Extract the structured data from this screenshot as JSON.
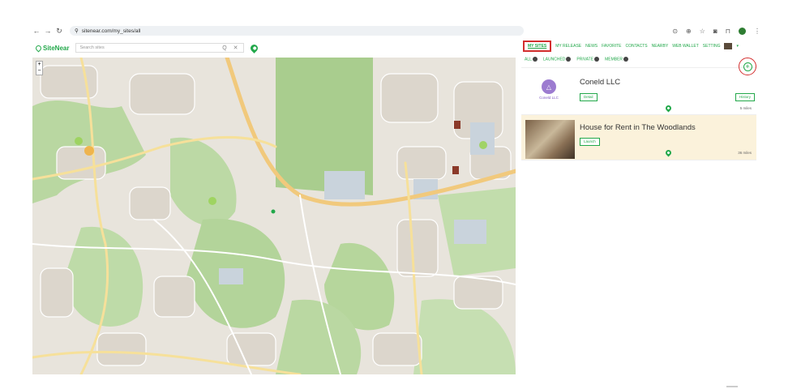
{
  "browser": {
    "url": "sitenear.com/my_sites/all",
    "nav_icons": [
      "back-icon",
      "forward-icon",
      "reload-icon"
    ],
    "right_icons": [
      "location-icon",
      "zoom-icon",
      "star-icon",
      "camera-icon",
      "extension-icon",
      "menu-icon"
    ]
  },
  "site": {
    "logo_text": "SiteNear",
    "search_placeholder": "Search sites",
    "search_tools": "Q ✕"
  },
  "nav": {
    "items": [
      "MY SITES",
      "MY RELEASE",
      "NEWS",
      "FAVORITE",
      "CONTACTS",
      "NEARBY",
      "WEB WALLET",
      "SETTING"
    ]
  },
  "tabs": {
    "items": [
      "ALL",
      "LAUNCHED",
      "PRIVATE",
      "MEMBER"
    ],
    "add_label": "+"
  },
  "cards": [
    {
      "title": "Coneld LLC",
      "logo_text": "Coneld LLC",
      "button": "Detail",
      "extra_button": "History",
      "distance": "5 miles"
    },
    {
      "title": "House for Rent in The Woodlands",
      "button": "Launch",
      "distance": "36 miles"
    }
  ],
  "map": {
    "zoom_in": "+",
    "zoom_out": "−",
    "colors": {
      "land": "#eae6df",
      "forest": "#b8d8a0",
      "road": "#f5d58a",
      "building": "#c9d3dc"
    }
  },
  "colors": {
    "accent": "#22a84a",
    "highlight_border": "#d32f2f",
    "card_highlight": "#fbf2db"
  }
}
